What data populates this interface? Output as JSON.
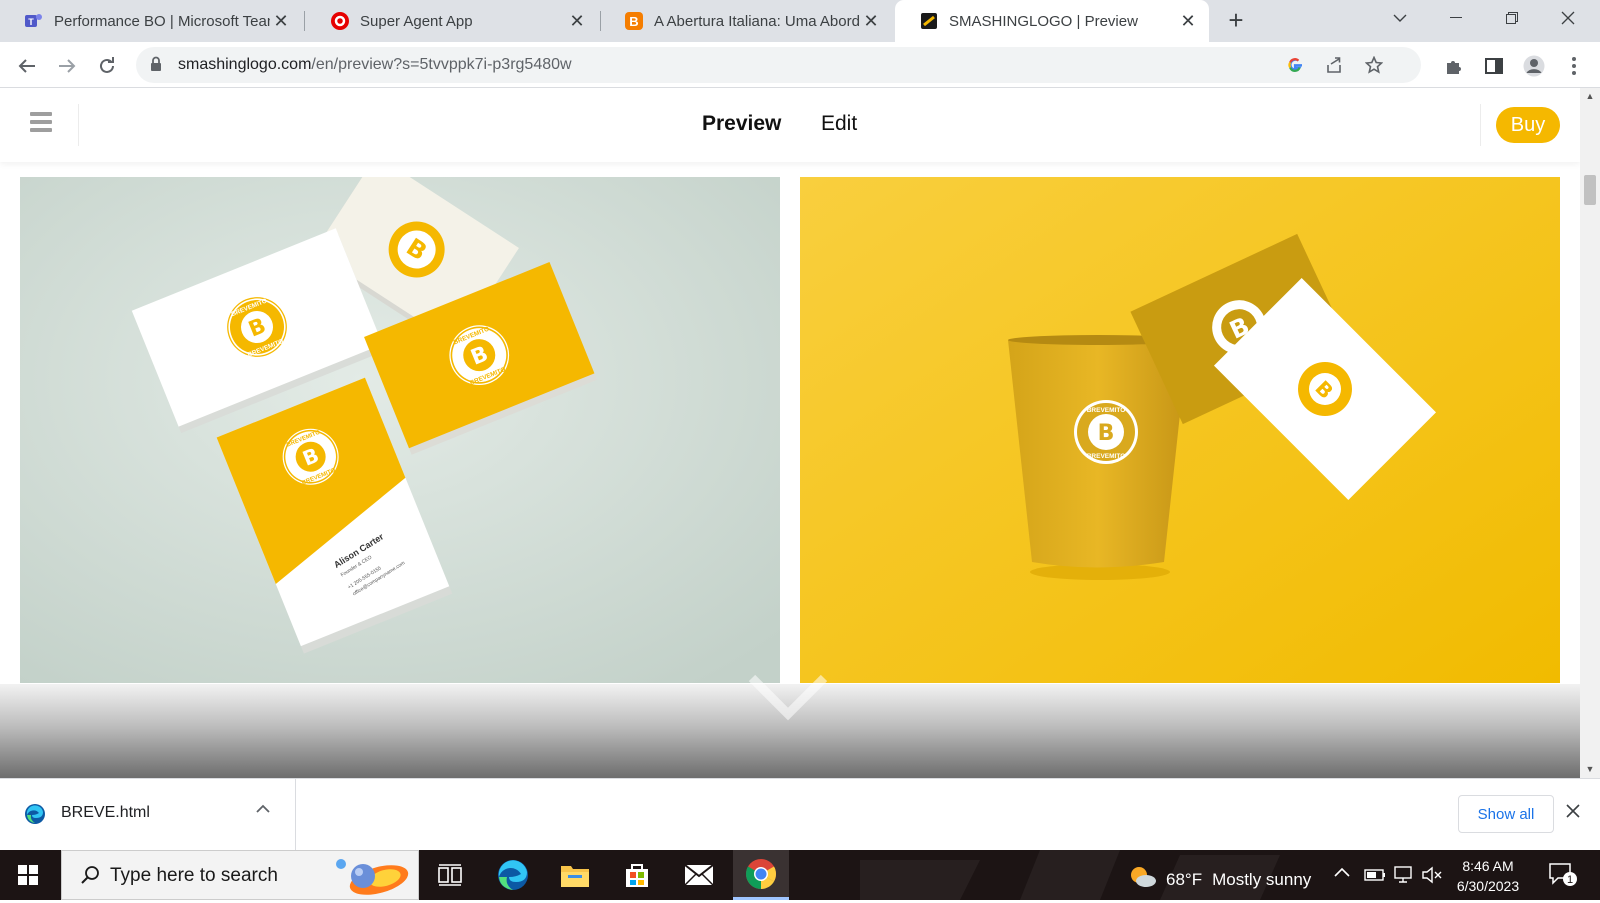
{
  "browser": {
    "tabs": [
      {
        "title": "Performance BO | Microsoft Teams",
        "icon": "teams-icon",
        "active": false
      },
      {
        "title": "Super Agent App",
        "icon": "vodafone-icon",
        "active": false
      },
      {
        "title": "A Abertura Italiana: Uma Abordagem",
        "icon": "blogger-icon",
        "active": false
      },
      {
        "title": "SMASHINGLOGO | Preview",
        "icon": "smashinglogo-icon",
        "active": true
      }
    ],
    "address": {
      "domain": "smashinglogo.com",
      "path": "/en/preview?s=5tvvppk7i-p3rg5480w"
    }
  },
  "site": {
    "nav": {
      "preview_label": "Preview",
      "edit_label": "Edit",
      "buy_label": "Buy"
    },
    "brand": {
      "logo_letter": "B",
      "logo_ring_text": "BREVEMITO",
      "card_name": "Alison Carter",
      "card_role": "Founder & CEO",
      "card_phone": "+1 205-555-0155",
      "card_email": "office@companyname.com",
      "accent": "#f5b800"
    }
  },
  "downloads": {
    "file_name": "BREVE.html",
    "show_all_label": "Show all"
  },
  "taskbar": {
    "search_placeholder": "Type here to search",
    "weather_temp": "68°F",
    "weather_text": "Mostly sunny",
    "time": "8:46 AM",
    "date": "6/30/2023",
    "notification_count": "1"
  }
}
